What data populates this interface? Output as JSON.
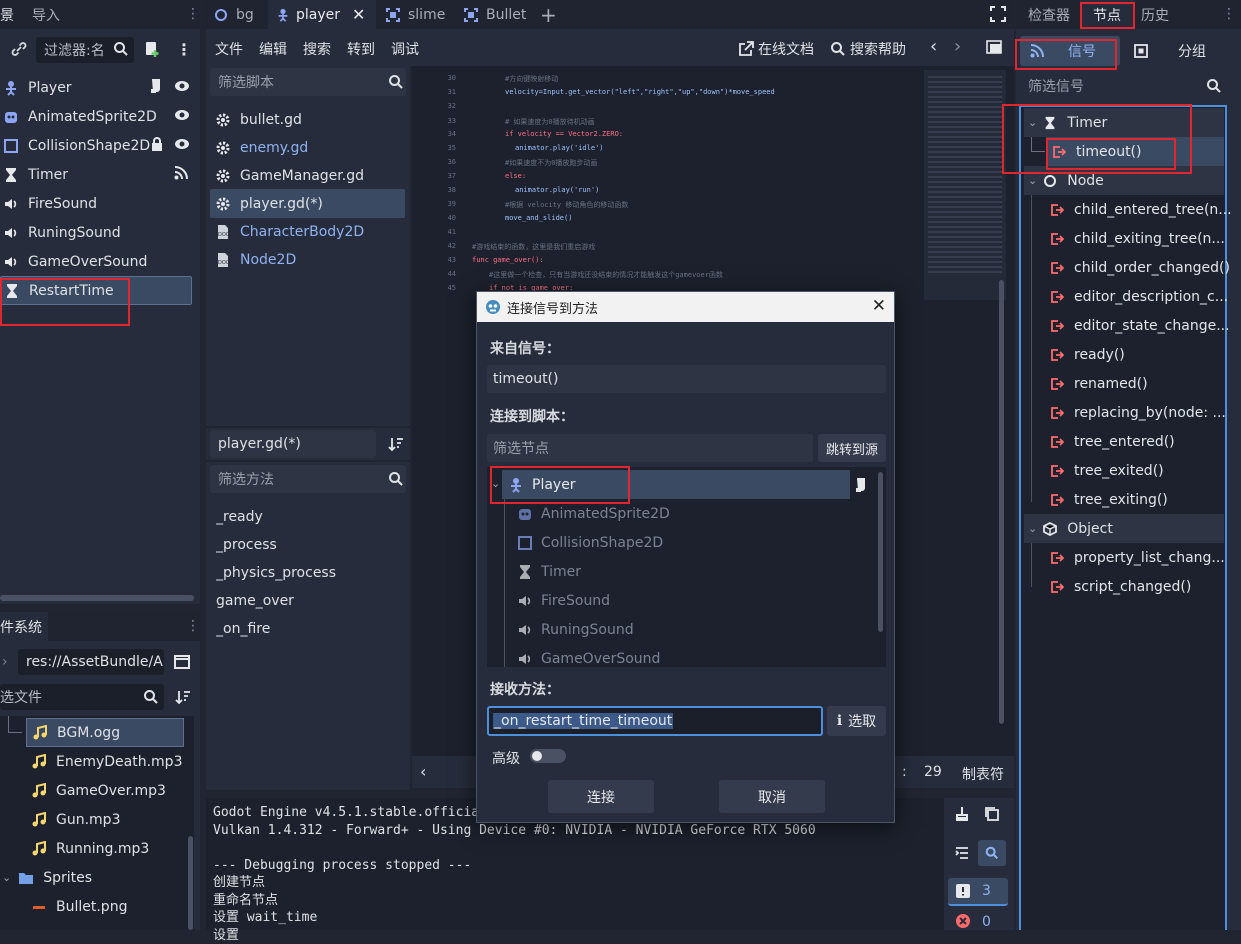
{
  "scene_dock": {
    "tabs": [
      "景",
      "导入"
    ],
    "filter_placeholder": "过滤器:名",
    "nodes": [
      {
        "name": "Player",
        "icon": "character-body-icon"
      },
      {
        "name": "AnimatedSprite2D",
        "icon": "animated-sprite-icon"
      },
      {
        "name": "CollisionShape2D",
        "icon": "collision-shape-icon"
      },
      {
        "name": "Timer",
        "icon": "hourglass-icon"
      },
      {
        "name": "FireSound",
        "icon": "speaker-icon"
      },
      {
        "name": "RuningSound",
        "icon": "speaker-icon"
      },
      {
        "name": "GameOverSound",
        "icon": "speaker-icon"
      },
      {
        "name": "RestartTime",
        "icon": "hourglass-icon"
      }
    ]
  },
  "filesystem": {
    "title": "件系统",
    "path": "res://AssetBundle/A",
    "filter_placeholder": "选文件",
    "files": [
      "BGM.ogg",
      "EnemyDeath.mp3",
      "GameOver.mp3",
      "Gun.mp3",
      "Running.mp3",
      "Sprites",
      "Bullet.png"
    ]
  },
  "editor_tabs": [
    "bg",
    "player",
    "slime",
    "Bullet"
  ],
  "menu": [
    "文件",
    "编辑",
    "搜索",
    "转到",
    "调试"
  ],
  "toolbar": {
    "online_docs": "在线文档",
    "search_help": "搜索帮助"
  },
  "script_list": {
    "filter_placeholder": "筛选脚本",
    "scripts": [
      "bullet.gd",
      "enemy.gd",
      "GameManager.gd",
      "player.gd(*)",
      "CharacterBody2D",
      "Node2D"
    ],
    "current": "player.gd(*)",
    "method_filter_placeholder": "筛选方法",
    "methods": [
      "_ready",
      "_process",
      "_physics_process",
      "game_over",
      "_on_fire"
    ]
  },
  "code_lines": [
    {
      "n": "30",
      "text": "#方向键映射移动"
    },
    {
      "n": "31",
      "text": "velocity=Input.get_vector(\"left\",\"right\",\"up\",\"down\")*move_speed"
    },
    {
      "n": "32",
      "text": ""
    },
    {
      "n": "33",
      "text": "# 如果速度为0播放待机动画"
    },
    {
      "n": "34",
      "text": "if velocity == Vector2.ZERO:"
    },
    {
      "n": "35",
      "text": "    animator.play('idle')"
    },
    {
      "n": "36",
      "text": "#如果速度不为0播放跑步动画"
    },
    {
      "n": "37",
      "text": "else:"
    },
    {
      "n": "38",
      "text": "    animator.play('run')"
    },
    {
      "n": "39",
      "text": "#根据 velocity 移动角色的移动函数"
    },
    {
      "n": "40",
      "text": "move_and_slide()"
    },
    {
      "n": "41",
      "text": ""
    },
    {
      "n": "42",
      "text": "#游戏结束的函数，这里是我们重启游戏"
    },
    {
      "n": "43",
      "text": "func game_over():"
    },
    {
      "n": "44",
      "text": "#这里做一个检查，只有当游戏还没结束的情况才能触发这个gamevoer函数"
    },
    {
      "n": "45",
      "text": "if not is_game_over:"
    }
  ],
  "status_bar": {
    "column": "29",
    "indent": "制表符"
  },
  "output": {
    "lines": [
      "Godot Engine v4.5.1.stable.officia",
      "Vulkan 1.4.312 - Forward+ - Using Device #0: NVIDIA - NVIDIA GeForce RTX 5060",
      "",
      "--- Debugging process stopped ---",
      "创建节点",
      "重命名节点",
      "设置 wait_time",
      "设置"
    ],
    "warning_count": "3",
    "error_count": "0"
  },
  "dialog": {
    "title": "连接信号到方法",
    "from_signal_label": "来自信号：",
    "signal": "timeout()",
    "connect_to_script_label": "连接到脚本：",
    "node_filter_placeholder": "筛选节点",
    "jump_button": "跳转到源",
    "tree": [
      {
        "name": "Player",
        "selected": true
      },
      {
        "name": "AnimatedSprite2D"
      },
      {
        "name": "CollisionShape2D"
      },
      {
        "name": "Timer"
      },
      {
        "name": "FireSound"
      },
      {
        "name": "RuningSound"
      },
      {
        "name": "GameOverSound"
      }
    ],
    "receiver_method_label": "接收方法：",
    "method_value": "_on_restart_time_timeout",
    "pick_button": "选取",
    "advanced_label": "高级",
    "connect_button": "连接",
    "cancel_button": "取消"
  },
  "right_dock": {
    "tabs": [
      "检查器",
      "节点",
      "历史"
    ],
    "subtabs": [
      "信号",
      "分组"
    ],
    "filter_placeholder": "筛选信号",
    "sections": [
      {
        "name": "Timer",
        "signals": [
          "timeout()"
        ]
      },
      {
        "name": "Node",
        "signals": [
          "child_entered_tree(n...",
          "child_exiting_tree(n...",
          "child_order_changed()",
          "editor_description_c...",
          "editor_state_change...",
          "ready()",
          "renamed()",
          "replacing_by(node: ...",
          "tree_entered()",
          "tree_exited()",
          "tree_exiting()"
        ]
      },
      {
        "name": "Object",
        "signals": [
          "property_list_chang...",
          "script_changed()"
        ]
      }
    ]
  },
  "colors": {
    "accent": "#4d8fd9",
    "highlight_box": "#e0262e",
    "signal_icon": "#ff6b6b",
    "selection": "#3b4a63"
  }
}
